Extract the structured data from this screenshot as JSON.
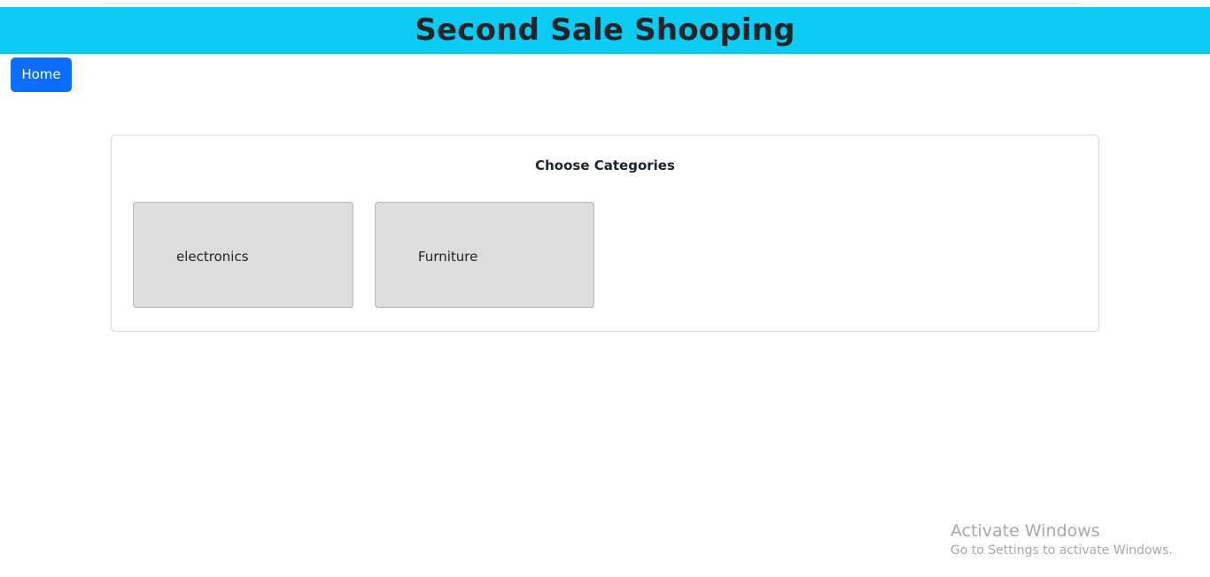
{
  "header": {
    "title": "Second Sale Shooping",
    "background_color": "#0dcaf0"
  },
  "nav": {
    "home_label": "Home",
    "home_color": "#0d6efd"
  },
  "categories": {
    "heading": "Choose Categories",
    "items": [
      {
        "label": "electronics"
      },
      {
        "label": "Furniture"
      }
    ],
    "tile_color": "#dddddd"
  },
  "watermark": {
    "title": "Activate Windows",
    "subtitle": "Go to Settings to activate Windows."
  }
}
